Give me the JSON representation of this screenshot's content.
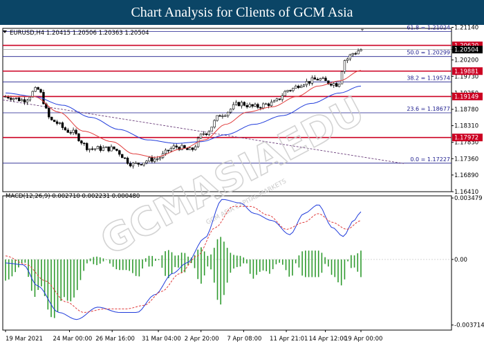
{
  "header": {
    "title": "Chart Analysis for Clients of GCM Asia"
  },
  "chart_data": {
    "type": "candlestick",
    "symbol_line": "EURUSD,H4  1.20415 1.20506 1.20363 1.20504",
    "ylim": [
      1.1641,
      1.2111
    ],
    "y_ticks": [
      "1.21140",
      "1.20500",
      "1.20200",
      "1.19730",
      "1.19250",
      "1.18780",
      "1.18310",
      "1.17830",
      "1.17360",
      "1.16890",
      "1.16410"
    ],
    "x_labels": [
      {
        "label": "19 Mar 2021",
        "pos": 0.0
      },
      {
        "label": "24 Mar 00:00",
        "pos": 0.18
      },
      {
        "label": "26 Mar 16:00",
        "pos": 0.3
      },
      {
        "label": "31 Mar 04:00",
        "pos": 0.43
      },
      {
        "label": "2 Apr 20:00",
        "pos": 0.55
      },
      {
        "label": "7 Apr 08:00",
        "pos": 0.67
      },
      {
        "label": "11 Apr 21:01",
        "pos": 0.79
      },
      {
        "label": "14 Apr 12:00",
        "pos": 0.9
      },
      {
        "label": "19 Apr 00:00",
        "pos": 1.0
      }
    ],
    "price_series_anchors": [
      {
        "t": 0.0,
        "p": 1.1915
      },
      {
        "t": 0.05,
        "p": 1.1905
      },
      {
        "t": 0.09,
        "p": 1.1935
      },
      {
        "t": 0.13,
        "p": 1.1845
      },
      {
        "t": 0.18,
        "p": 1.1815
      },
      {
        "t": 0.24,
        "p": 1.1765
      },
      {
        "t": 0.3,
        "p": 1.1765
      },
      {
        "t": 0.36,
        "p": 1.172
      },
      {
        "t": 0.42,
        "p": 1.1735
      },
      {
        "t": 0.48,
        "p": 1.177
      },
      {
        "t": 0.52,
        "p": 1.176
      },
      {
        "t": 0.56,
        "p": 1.181
      },
      {
        "t": 0.61,
        "p": 1.1865
      },
      {
        "t": 0.66,
        "p": 1.1895
      },
      {
        "t": 0.7,
        "p": 1.1885
      },
      {
        "t": 0.75,
        "p": 1.1895
      },
      {
        "t": 0.8,
        "p": 1.1935
      },
      {
        "t": 0.84,
        "p": 1.1955
      },
      {
        "t": 0.88,
        "p": 1.1965
      },
      {
        "t": 0.91,
        "p": 1.1955
      },
      {
        "t": 0.935,
        "p": 1.195
      },
      {
        "t": 0.955,
        "p": 1.202
      },
      {
        "t": 0.98,
        "p": 1.204
      },
      {
        "t": 1.0,
        "p": 1.205
      }
    ],
    "ma_fast_anchors": [
      {
        "t": 0.0,
        "p": 1.1915
      },
      {
        "t": 0.08,
        "p": 1.1915
      },
      {
        "t": 0.15,
        "p": 1.187
      },
      {
        "t": 0.22,
        "p": 1.1815
      },
      {
        "t": 0.3,
        "p": 1.1785
      },
      {
        "t": 0.36,
        "p": 1.175
      },
      {
        "t": 0.42,
        "p": 1.174
      },
      {
        "t": 0.5,
        "p": 1.1765
      },
      {
        "t": 0.56,
        "p": 1.179
      },
      {
        "t": 0.62,
        "p": 1.1835
      },
      {
        "t": 0.68,
        "p": 1.187
      },
      {
        "t": 0.75,
        "p": 1.1885
      },
      {
        "t": 0.82,
        "p": 1.1915
      },
      {
        "t": 0.88,
        "p": 1.1945
      },
      {
        "t": 0.94,
        "p": 1.196
      },
      {
        "t": 1.0,
        "p": 1.199
      }
    ],
    "ma_slow_anchors": [
      {
        "t": 0.0,
        "p": 1.1925
      },
      {
        "t": 0.08,
        "p": 1.1915
      },
      {
        "t": 0.16,
        "p": 1.189
      },
      {
        "t": 0.24,
        "p": 1.1855
      },
      {
        "t": 0.32,
        "p": 1.182
      },
      {
        "t": 0.4,
        "p": 1.179
      },
      {
        "t": 0.48,
        "p": 1.178
      },
      {
        "t": 0.55,
        "p": 1.1785
      },
      {
        "t": 0.62,
        "p": 1.1805
      },
      {
        "t": 0.7,
        "p": 1.1835
      },
      {
        "t": 0.78,
        "p": 1.186
      },
      {
        "t": 0.86,
        "p": 1.1895
      },
      {
        "t": 0.94,
        "p": 1.1925
      },
      {
        "t": 1.0,
        "p": 1.1945
      }
    ],
    "trend_line": {
      "p_start": 1.1905,
      "p_end": 1.1722
    },
    "horizontal_levels": [
      {
        "price": 1.2102,
        "type": "fib",
        "label": "61.8 = 1.21024"
      },
      {
        "price": 1.2062,
        "type": "resistance",
        "tag": "1.20620"
      },
      {
        "price": 1.205,
        "type": "current",
        "tag": "1.20504"
      },
      {
        "price": 1.203,
        "type": "fib",
        "label": "50.0 = 1.20299"
      },
      {
        "price": 1.1988,
        "type": "resistance",
        "tag": "1.19881"
      },
      {
        "price": 1.1957,
        "type": "fib",
        "label": "38.2 = 1.19574"
      },
      {
        "price": 1.1915,
        "type": "resistance",
        "tag": "1.19149"
      },
      {
        "price": 1.1868,
        "type": "fib",
        "label": "23.6 = 1.18677"
      },
      {
        "price": 1.1797,
        "type": "resistance",
        "tag": "1.17972"
      },
      {
        "price": 1.1723,
        "type": "fib",
        "label": "0.0 = 1.17227"
      }
    ],
    "macd": {
      "label": "MACD(12,26,9) 0.002710 0.002231 0.000480",
      "ylim": [
        -0.004,
        0.0036
      ],
      "y_ticks": [
        {
          "v": 0.003479,
          "label": "0.003479"
        },
        {
          "v": 0.0,
          "label": "0.00"
        },
        {
          "v": -0.003714,
          "label": "-0.003714"
        }
      ],
      "main_anchors": [
        {
          "t": 0.0,
          "v": -0.0002
        },
        {
          "t": 0.05,
          "v": -0.0003
        },
        {
          "t": 0.09,
          "v": -0.0015
        },
        {
          "t": 0.15,
          "v": -0.003
        },
        {
          "t": 0.2,
          "v": -0.0034
        },
        {
          "t": 0.26,
          "v": -0.0027
        },
        {
          "t": 0.32,
          "v": -0.003
        },
        {
          "t": 0.37,
          "v": -0.003
        },
        {
          "t": 0.42,
          "v": -0.002
        },
        {
          "t": 0.47,
          "v": -0.0008
        },
        {
          "t": 0.51,
          "v": -0.0002
        },
        {
          "t": 0.56,
          "v": 0.0012
        },
        {
          "t": 0.61,
          "v": 0.0034
        },
        {
          "t": 0.66,
          "v": 0.0032
        },
        {
          "t": 0.7,
          "v": 0.0026
        },
        {
          "t": 0.75,
          "v": 0.0022
        },
        {
          "t": 0.8,
          "v": 0.0014
        },
        {
          "t": 0.84,
          "v": 0.0026
        },
        {
          "t": 0.88,
          "v": 0.0031
        },
        {
          "t": 0.92,
          "v": 0.0018
        },
        {
          "t": 0.95,
          "v": 0.0013
        },
        {
          "t": 0.98,
          "v": 0.0022
        },
        {
          "t": 1.0,
          "v": 0.0027
        }
      ],
      "signal_anchors": [
        {
          "t": 0.0,
          "v": 0.0002
        },
        {
          "t": 0.06,
          "v": -0.0003
        },
        {
          "t": 0.11,
          "v": -0.0012
        },
        {
          "t": 0.17,
          "v": -0.0024
        },
        {
          "t": 0.22,
          "v": -0.003
        },
        {
          "t": 0.28,
          "v": -0.0028
        },
        {
          "t": 0.34,
          "v": -0.0028
        },
        {
          "t": 0.39,
          "v": -0.0026
        },
        {
          "t": 0.44,
          "v": -0.0018
        },
        {
          "t": 0.49,
          "v": -0.0008
        },
        {
          "t": 0.54,
          "v": 0.0002
        },
        {
          "t": 0.59,
          "v": 0.0018
        },
        {
          "t": 0.64,
          "v": 0.003
        },
        {
          "t": 0.69,
          "v": 0.003
        },
        {
          "t": 0.74,
          "v": 0.0025
        },
        {
          "t": 0.79,
          "v": 0.0017
        },
        {
          "t": 0.84,
          "v": 0.0021
        },
        {
          "t": 0.88,
          "v": 0.0026
        },
        {
          "t": 0.92,
          "v": 0.0021
        },
        {
          "t": 0.96,
          "v": 0.0017
        },
        {
          "t": 1.0,
          "v": 0.0022
        }
      ]
    },
    "colors": {
      "up_candle": "#ffffff",
      "down_candle": "#000000",
      "ma_fast": "#e03a3a",
      "ma_slow": "#1f3bdb",
      "trend": "#6a3d7a",
      "resistance": "#cc0022",
      "fib": "#1a1a8c",
      "macd_hist": "#2e9a2e",
      "macd_main": "#1f3bdb",
      "macd_signal": "#e03a3a",
      "tag_bg": "#cc0022",
      "current_bg": "#000000",
      "header_bg": "#0b4566"
    }
  }
}
